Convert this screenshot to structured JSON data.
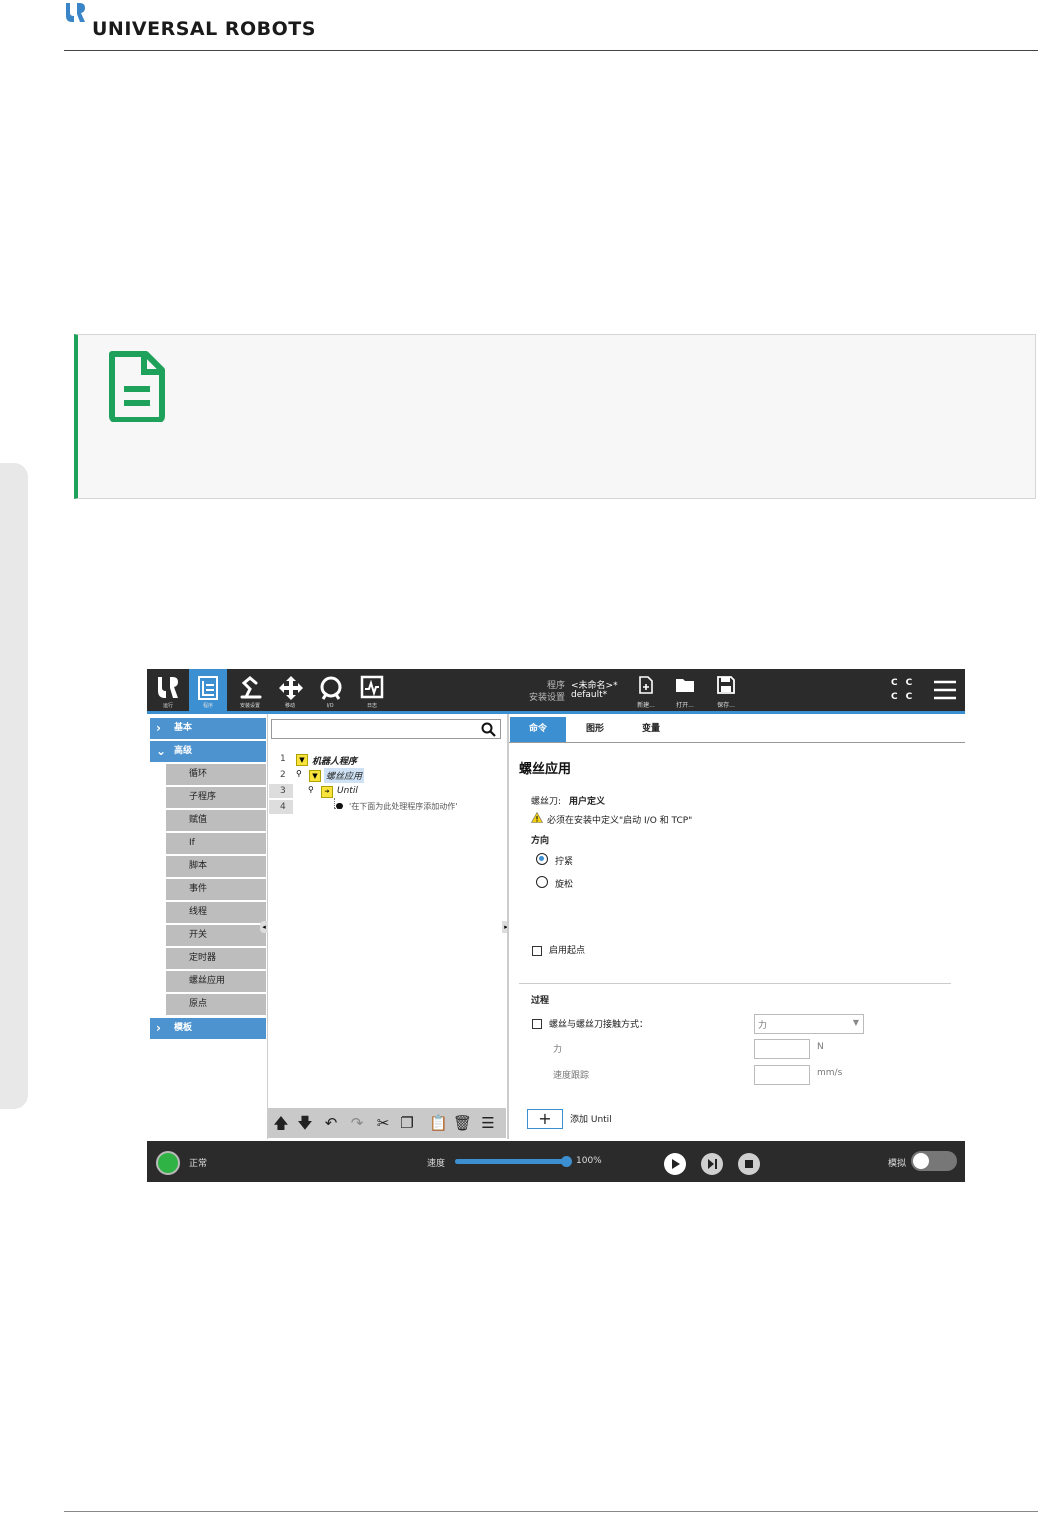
{
  "page": {
    "brand_text": "UNIVERSAL ROBOTS"
  },
  "screen": {
    "topbar": {
      "nav": [
        {
          "label": "运行",
          "icon": "ur-logo-icon"
        },
        {
          "label": "程序",
          "icon": "program-icon"
        },
        {
          "label": "安装设置",
          "icon": "robot-arm-icon"
        },
        {
          "label": "移动",
          "icon": "move-icon"
        },
        {
          "label": "I/O",
          "icon": "io-icon"
        },
        {
          "label": "日志",
          "icon": "log-icon"
        }
      ],
      "program_label": "程序",
      "program_value": "<未命名>*",
      "install_label": "安装设置",
      "install_value": "default*",
      "file": [
        {
          "label": "新建...",
          "icon": "new-file-icon"
        },
        {
          "label": "打开...",
          "icon": "open-folder-icon"
        },
        {
          "label": "保存...",
          "icon": "save-icon"
        }
      ],
      "cc_icons": [
        "C",
        "C",
        "C",
        "C"
      ]
    },
    "left_panel": {
      "categories": [
        {
          "label": "基本",
          "expanded": false
        },
        {
          "label": "高级",
          "expanded": true
        },
        {
          "label": "模板",
          "expanded": false
        }
      ],
      "advanced_items": [
        "循环",
        "子程序",
        "赋值",
        "If",
        "脚本",
        "事件",
        "线程",
        "开关",
        "定时器",
        "螺丝应用",
        "原点"
      ]
    },
    "tree": {
      "search_placeholder": "",
      "lines": [
        {
          "num": "1",
          "text": "机器人程序"
        },
        {
          "num": "2",
          "text": "螺丝应用"
        },
        {
          "num": "3",
          "text": "Until"
        },
        {
          "num": "4",
          "text": "'在下面为此处理程序添加动作'"
        }
      ]
    },
    "right_panel": {
      "tabs": [
        "命令",
        "图形",
        "变量"
      ],
      "active_tab": "命令",
      "title": "螺丝应用",
      "screwdriver_label": "螺丝刀:",
      "screwdriver_value": "用户定义",
      "warning": "必须在安装中定义\"启动 I/O 和 TCP\"",
      "direction_label": "方向",
      "direction_options": [
        {
          "label": "拧紧",
          "selected": true
        },
        {
          "label": "旋松",
          "selected": false
        }
      ],
      "start_point_label": "启用起点",
      "process_label": "过程",
      "contact_label": "螺丝与螺丝刀接触方式：",
      "contact_select": "力",
      "force_label": "力",
      "force_unit": "N",
      "speed_label": "速度跟踪",
      "speed_unit": "mm/s",
      "add_until_label": "添加 Until"
    },
    "status_bar": {
      "status_text": "正常",
      "speed_label": "速度",
      "speed_value": "100%",
      "speed_fraction": 1.0,
      "sim_label": "模拟"
    }
  },
  "colors": {
    "note_accent": "#1ea15a",
    "ur_blue": "#3c8fd1",
    "topbar": "#2b2b2b"
  }
}
